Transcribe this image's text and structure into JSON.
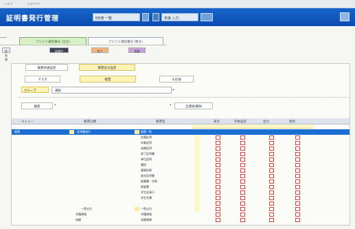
{
  "topbar": {
    "left_text": "ヘルプ",
    "right_text": "ログアウト"
  },
  "header": {
    "title": "証明書発行管理",
    "field1": "Ⅱ年度 一覧",
    "field2": "年度 入力",
    "accent": "#0b4ab0"
  },
  "tabs": {
    "active": "アルファ識別番号 (全文)",
    "inactive": "アルファ識別番号 (略文)"
  },
  "legend": {
    "a": "未処理",
    "b": "処理中",
    "c": "完了",
    "d": "保留"
  },
  "subtabs": {
    "first": "業務共通設定",
    "second": "帳票出力設定"
  },
  "modes": {
    "left": "マスタ",
    "center": "帳票",
    "right": "その他"
  },
  "filter": {
    "label": "グループ",
    "value": "選択"
  },
  "buttons": {
    "search": "検索",
    "toggle": "全選択/解除"
  },
  "columns": {
    "menu": "メニュー",
    "category": "帳票分類",
    "name": "帳票名",
    "c1": "表示",
    "c2": "印刷設定",
    "c3": "出力",
    "c4": "更新"
  },
  "tree": {
    "level1": "帳票",
    "level2": "証明書発行",
    "items": [
      "帳票一覧",
      "在籍証明",
      "卒業証明",
      "成績証明",
      "修了証明書",
      "単位証明",
      "履修",
      "健康診断",
      "進学証明書",
      "推薦書・学割",
      "調査書",
      "学生証発行",
      "学生名簿"
    ],
    "lower_cat": [
      "一覧出力",
      "学籍情報",
      "成績"
    ],
    "lower_items": [
      "一覧出力",
      "学籍情報",
      "成績情報"
    ]
  }
}
